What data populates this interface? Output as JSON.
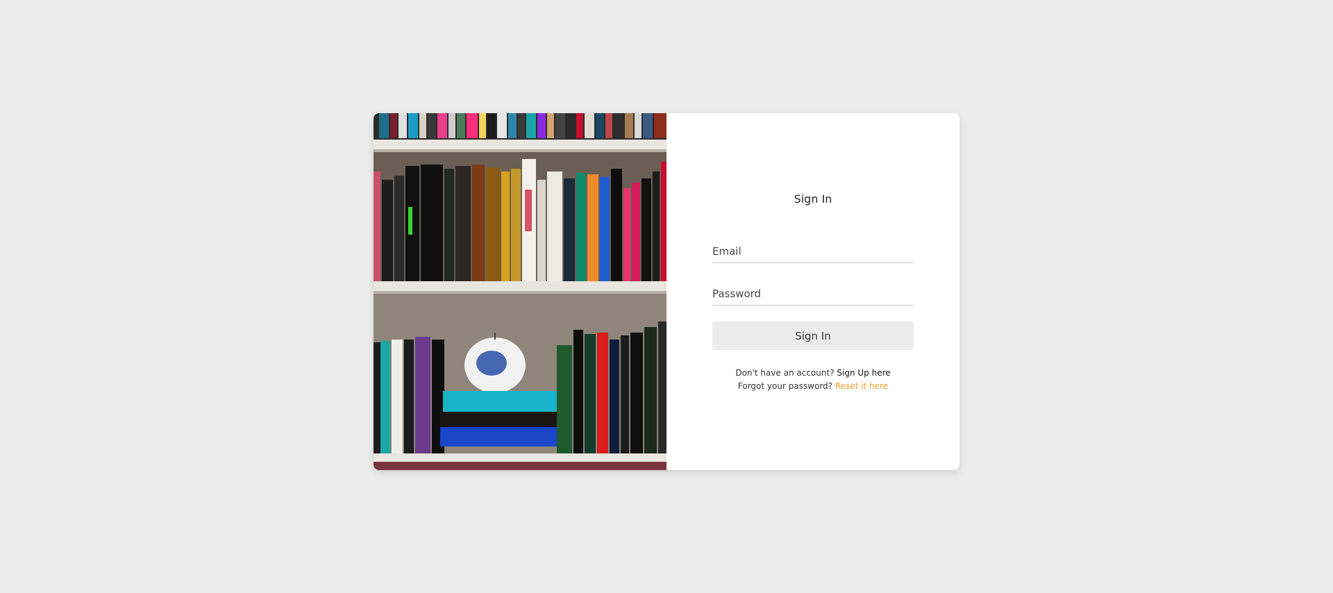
{
  "hero_image": {
    "description_icon": "bookshelf-photo"
  },
  "form": {
    "title": "Sign In",
    "email_placeholder": "Email",
    "password_placeholder": "Password",
    "submit_label": "Sign In"
  },
  "links": {
    "signup_prompt": "Don't have an account?",
    "signup_link": "Sign Up here",
    "reset_prompt": "Forgot your password?",
    "reset_link": "Reset it here"
  },
  "colors": {
    "background": "#ececec",
    "card": "#ffffff",
    "accent": "#f39c25",
    "button": "#ececec"
  }
}
